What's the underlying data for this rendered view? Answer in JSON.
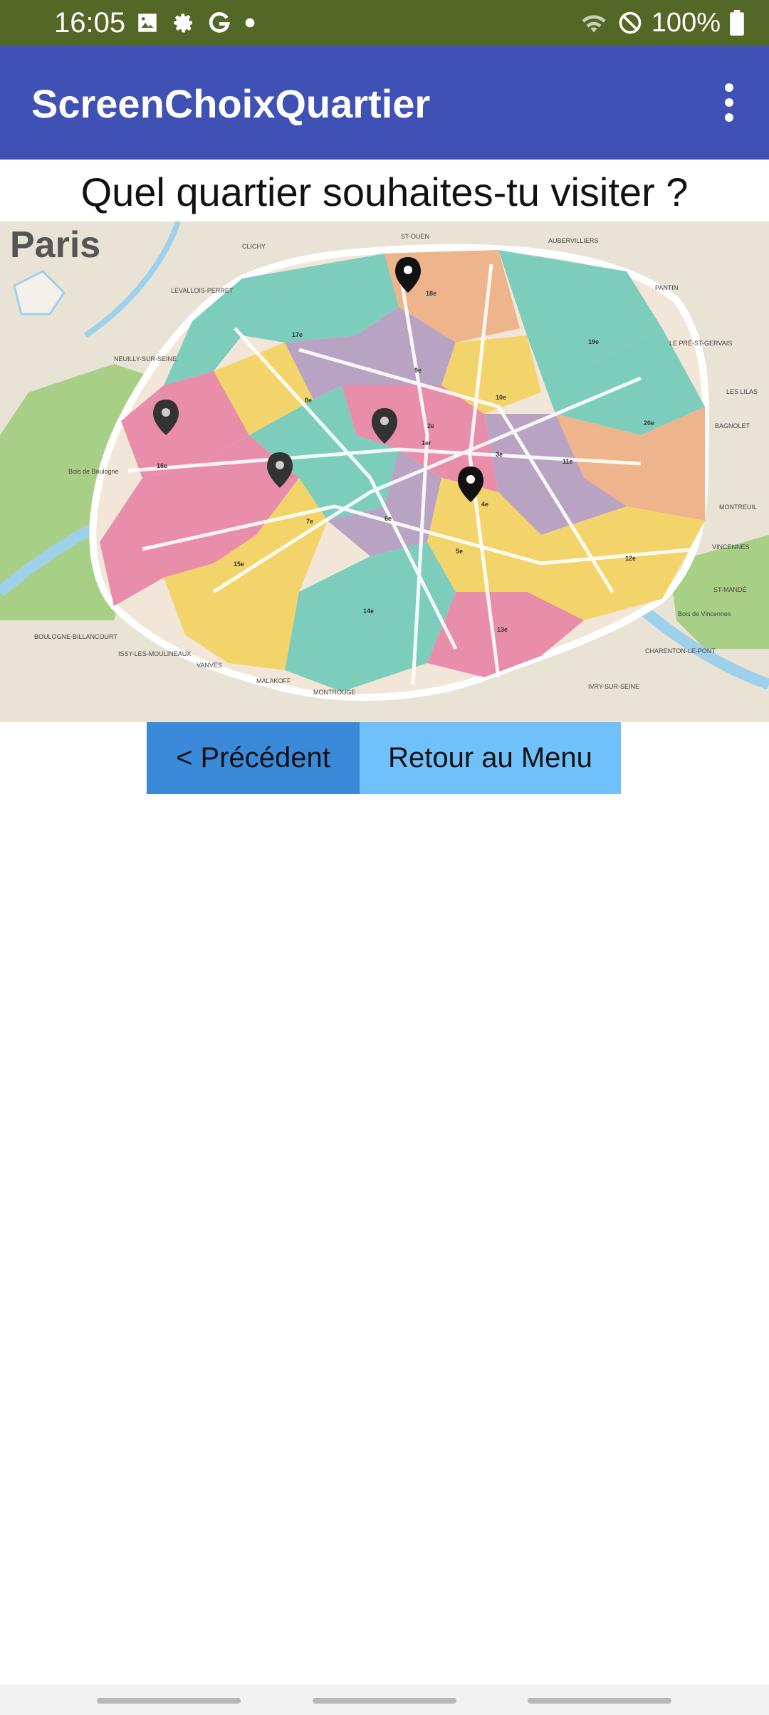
{
  "status_bar": {
    "time": "16:05",
    "battery": "100%",
    "icons": [
      "image-icon",
      "gear-icon",
      "google-icon",
      "dot-icon",
      "wifi-icon",
      "do-not-disturb-icon",
      "battery-icon"
    ]
  },
  "app_bar": {
    "title": "ScreenChoixQuartier",
    "menu_icon": "more-vert-icon"
  },
  "question": "Quel quartier souhaites-tu visiter ?",
  "map": {
    "city_label": "Paris",
    "labels": {
      "clichy": "CLICHY",
      "st_ouen": "ST-OUEN",
      "aubervilliers": "AUBERVILLIERS",
      "levallois": "LEVALLOIS-PERRET",
      "neuilly": "NEUILLY-SUR-SEINE",
      "pantin": "PANTIN",
      "le_pre": "LE PRÉ-ST-GERVAIS",
      "les_lilas": "LES LILAS",
      "bagnolet": "BAGNOLET",
      "montreuil": "MONTREUIL",
      "vincennes": "VINCENNES",
      "st_mande": "ST-MANDÉ",
      "charenton": "CHARENTON-LE-PONT",
      "ivry": "IVRY-SUR-SEINE",
      "montrouge": "MONTROUGE",
      "malakoff": "MALAKOFF",
      "vanves": "VANVES",
      "issy": "ISSY-LES-MOULINEAUX",
      "boulogne": "BOULOGNE-BILLANCOURT",
      "bois_boulogne": "Bois de Boulogne",
      "bois_vincennes": "Bois de Vincennes"
    },
    "arrondissements": [
      "1er",
      "2e",
      "3e",
      "4e",
      "5e",
      "6e",
      "7e",
      "8e",
      "9e",
      "10e",
      "11e",
      "12e",
      "13e",
      "14e",
      "15e",
      "16e",
      "17e",
      "18e",
      "19e",
      "20e"
    ],
    "pins": 5
  },
  "buttons": {
    "prev": "< Précédent",
    "menu": "Retour au Menu"
  },
  "colors": {
    "status_bar": "#536826",
    "app_bar": "#3f51b5",
    "prev_button": "#3b8ad9",
    "menu_button": "#70c0fb"
  }
}
